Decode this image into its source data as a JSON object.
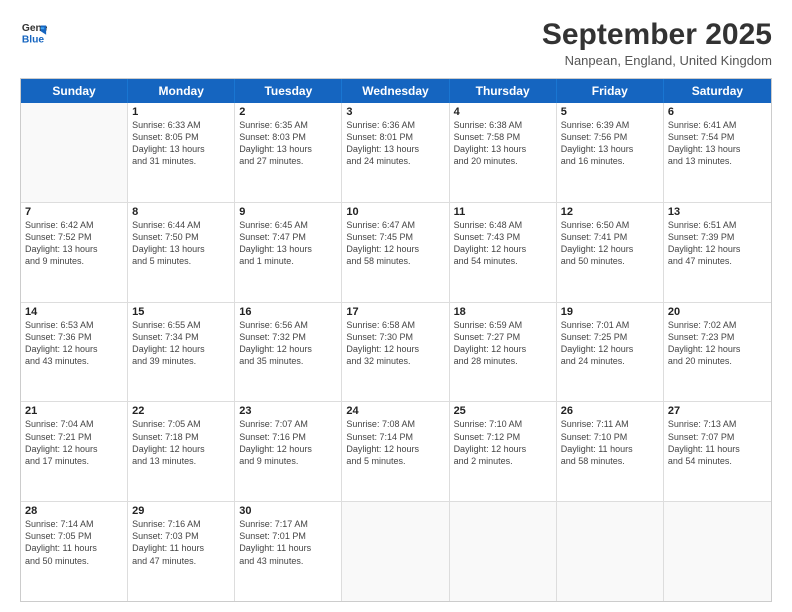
{
  "header": {
    "logo_line1": "General",
    "logo_line2": "Blue",
    "month_title": "September 2025",
    "location": "Nanpean, England, United Kingdom"
  },
  "weekdays": [
    "Sunday",
    "Monday",
    "Tuesday",
    "Wednesday",
    "Thursday",
    "Friday",
    "Saturday"
  ],
  "rows": [
    [
      {
        "day": "",
        "lines": []
      },
      {
        "day": "1",
        "lines": [
          "Sunrise: 6:33 AM",
          "Sunset: 8:05 PM",
          "Daylight: 13 hours",
          "and 31 minutes."
        ]
      },
      {
        "day": "2",
        "lines": [
          "Sunrise: 6:35 AM",
          "Sunset: 8:03 PM",
          "Daylight: 13 hours",
          "and 27 minutes."
        ]
      },
      {
        "day": "3",
        "lines": [
          "Sunrise: 6:36 AM",
          "Sunset: 8:01 PM",
          "Daylight: 13 hours",
          "and 24 minutes."
        ]
      },
      {
        "day": "4",
        "lines": [
          "Sunrise: 6:38 AM",
          "Sunset: 7:58 PM",
          "Daylight: 13 hours",
          "and 20 minutes."
        ]
      },
      {
        "day": "5",
        "lines": [
          "Sunrise: 6:39 AM",
          "Sunset: 7:56 PM",
          "Daylight: 13 hours",
          "and 16 minutes."
        ]
      },
      {
        "day": "6",
        "lines": [
          "Sunrise: 6:41 AM",
          "Sunset: 7:54 PM",
          "Daylight: 13 hours",
          "and 13 minutes."
        ]
      }
    ],
    [
      {
        "day": "7",
        "lines": [
          "Sunrise: 6:42 AM",
          "Sunset: 7:52 PM",
          "Daylight: 13 hours",
          "and 9 minutes."
        ]
      },
      {
        "day": "8",
        "lines": [
          "Sunrise: 6:44 AM",
          "Sunset: 7:50 PM",
          "Daylight: 13 hours",
          "and 5 minutes."
        ]
      },
      {
        "day": "9",
        "lines": [
          "Sunrise: 6:45 AM",
          "Sunset: 7:47 PM",
          "Daylight: 13 hours",
          "and 1 minute."
        ]
      },
      {
        "day": "10",
        "lines": [
          "Sunrise: 6:47 AM",
          "Sunset: 7:45 PM",
          "Daylight: 12 hours",
          "and 58 minutes."
        ]
      },
      {
        "day": "11",
        "lines": [
          "Sunrise: 6:48 AM",
          "Sunset: 7:43 PM",
          "Daylight: 12 hours",
          "and 54 minutes."
        ]
      },
      {
        "day": "12",
        "lines": [
          "Sunrise: 6:50 AM",
          "Sunset: 7:41 PM",
          "Daylight: 12 hours",
          "and 50 minutes."
        ]
      },
      {
        "day": "13",
        "lines": [
          "Sunrise: 6:51 AM",
          "Sunset: 7:39 PM",
          "Daylight: 12 hours",
          "and 47 minutes."
        ]
      }
    ],
    [
      {
        "day": "14",
        "lines": [
          "Sunrise: 6:53 AM",
          "Sunset: 7:36 PM",
          "Daylight: 12 hours",
          "and 43 minutes."
        ]
      },
      {
        "day": "15",
        "lines": [
          "Sunrise: 6:55 AM",
          "Sunset: 7:34 PM",
          "Daylight: 12 hours",
          "and 39 minutes."
        ]
      },
      {
        "day": "16",
        "lines": [
          "Sunrise: 6:56 AM",
          "Sunset: 7:32 PM",
          "Daylight: 12 hours",
          "and 35 minutes."
        ]
      },
      {
        "day": "17",
        "lines": [
          "Sunrise: 6:58 AM",
          "Sunset: 7:30 PM",
          "Daylight: 12 hours",
          "and 32 minutes."
        ]
      },
      {
        "day": "18",
        "lines": [
          "Sunrise: 6:59 AM",
          "Sunset: 7:27 PM",
          "Daylight: 12 hours",
          "and 28 minutes."
        ]
      },
      {
        "day": "19",
        "lines": [
          "Sunrise: 7:01 AM",
          "Sunset: 7:25 PM",
          "Daylight: 12 hours",
          "and 24 minutes."
        ]
      },
      {
        "day": "20",
        "lines": [
          "Sunrise: 7:02 AM",
          "Sunset: 7:23 PM",
          "Daylight: 12 hours",
          "and 20 minutes."
        ]
      }
    ],
    [
      {
        "day": "21",
        "lines": [
          "Sunrise: 7:04 AM",
          "Sunset: 7:21 PM",
          "Daylight: 12 hours",
          "and 17 minutes."
        ]
      },
      {
        "day": "22",
        "lines": [
          "Sunrise: 7:05 AM",
          "Sunset: 7:18 PM",
          "Daylight: 12 hours",
          "and 13 minutes."
        ]
      },
      {
        "day": "23",
        "lines": [
          "Sunrise: 7:07 AM",
          "Sunset: 7:16 PM",
          "Daylight: 12 hours",
          "and 9 minutes."
        ]
      },
      {
        "day": "24",
        "lines": [
          "Sunrise: 7:08 AM",
          "Sunset: 7:14 PM",
          "Daylight: 12 hours",
          "and 5 minutes."
        ]
      },
      {
        "day": "25",
        "lines": [
          "Sunrise: 7:10 AM",
          "Sunset: 7:12 PM",
          "Daylight: 12 hours",
          "and 2 minutes."
        ]
      },
      {
        "day": "26",
        "lines": [
          "Sunrise: 7:11 AM",
          "Sunset: 7:10 PM",
          "Daylight: 11 hours",
          "and 58 minutes."
        ]
      },
      {
        "day": "27",
        "lines": [
          "Sunrise: 7:13 AM",
          "Sunset: 7:07 PM",
          "Daylight: 11 hours",
          "and 54 minutes."
        ]
      }
    ],
    [
      {
        "day": "28",
        "lines": [
          "Sunrise: 7:14 AM",
          "Sunset: 7:05 PM",
          "Daylight: 11 hours",
          "and 50 minutes."
        ]
      },
      {
        "day": "29",
        "lines": [
          "Sunrise: 7:16 AM",
          "Sunset: 7:03 PM",
          "Daylight: 11 hours",
          "and 47 minutes."
        ]
      },
      {
        "day": "30",
        "lines": [
          "Sunrise: 7:17 AM",
          "Sunset: 7:01 PM",
          "Daylight: 11 hours",
          "and 43 minutes."
        ]
      },
      {
        "day": "",
        "lines": []
      },
      {
        "day": "",
        "lines": []
      },
      {
        "day": "",
        "lines": []
      },
      {
        "day": "",
        "lines": []
      }
    ]
  ]
}
